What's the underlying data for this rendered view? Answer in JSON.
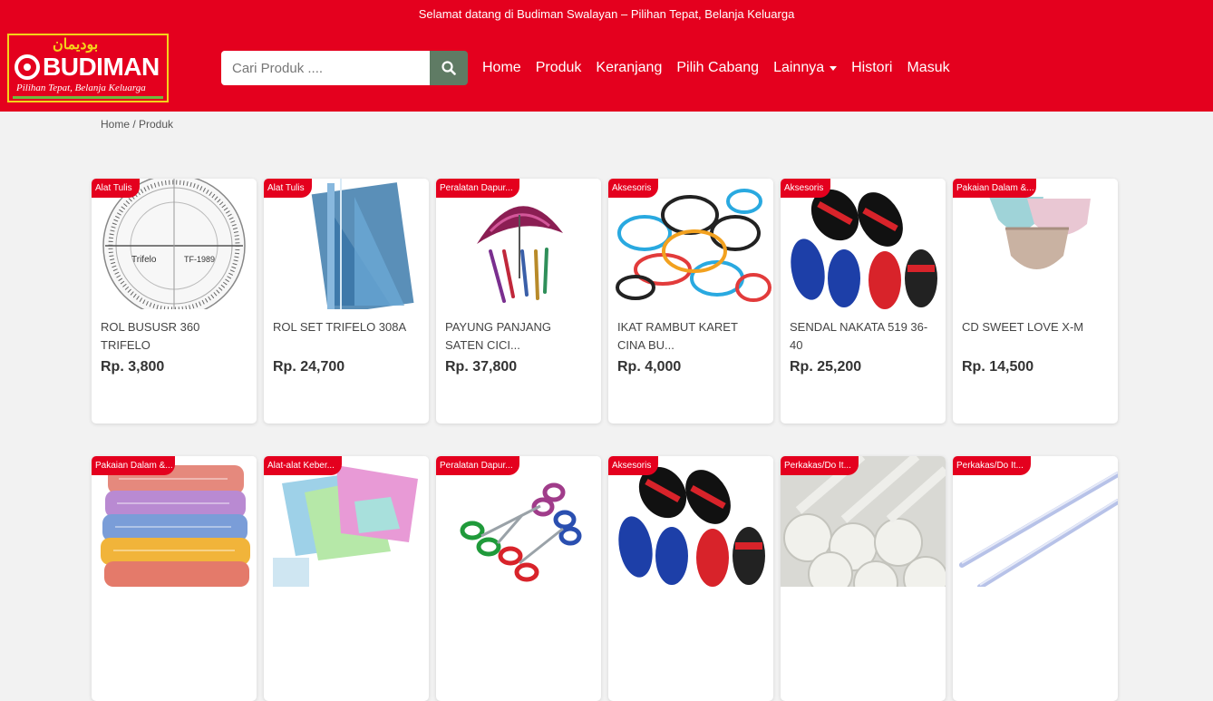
{
  "header": {
    "welcome": "Selamat datang di Budiman Swalayan – Pilihan Tepat, Belanja Keluarga",
    "logo": {
      "arabic": "بوديمان",
      "brand": "BUDIMAN",
      "tagline": "Pilihan Tepat, Belanja Keluarga"
    },
    "search": {
      "placeholder": "Cari Produk ...."
    },
    "nav": [
      "Home",
      "Produk",
      "Keranjang",
      "Pilih Cabang",
      "Lainnya",
      "Histori",
      "Masuk"
    ]
  },
  "breadcrumb": "Home / Produk",
  "products": [
    {
      "badge": "Alat Tulis",
      "title": "ROL BUSUSR 360 TRIFELO",
      "price": "Rp. 3,800",
      "image": "protractor"
    },
    {
      "badge": "Alat Tulis",
      "title": "ROL SET TRIFELO 308A",
      "price": "Rp. 24,700",
      "image": "ruler-set"
    },
    {
      "badge": "Peralatan Dapur...",
      "title": "PAYUNG PANJANG SATEN CICI...",
      "price": "Rp. 37,800",
      "image": "umbrella"
    },
    {
      "badge": "Aksesoris",
      "title": "IKAT RAMBUT KARET CINA BU...",
      "price": "Rp. 4,000",
      "image": "hair-ties"
    },
    {
      "badge": "Aksesoris",
      "title": "SENDAL NAKATA 519 36-40",
      "price": "Rp. 25,200",
      "image": "sandals"
    },
    {
      "badge": "Pakaian Dalam &...",
      "title": "CD SWEET LOVE X-M",
      "price": "Rp. 14,500",
      "image": "underwear"
    },
    {
      "badge": "Pakaian Dalam &...",
      "title": "",
      "price": "",
      "image": "towels"
    },
    {
      "badge": "Alat-alat Keber...",
      "title": "",
      "price": "",
      "image": "cloths"
    },
    {
      "badge": "Peralatan Dapur...",
      "title": "",
      "price": "",
      "image": "scissors"
    },
    {
      "badge": "Aksesoris",
      "title": "",
      "price": "",
      "image": "sandals"
    },
    {
      "badge": "Perkakas/Do It...",
      "title": "",
      "price": "",
      "image": "glue-sticks"
    },
    {
      "badge": "Perkakas/Do It...",
      "title": "",
      "price": "",
      "image": "glue-rods"
    }
  ],
  "colors": {
    "brand_red": "#e4001e",
    "search_button": "#5f7b64",
    "logo_yellow": "#f4d21a"
  }
}
